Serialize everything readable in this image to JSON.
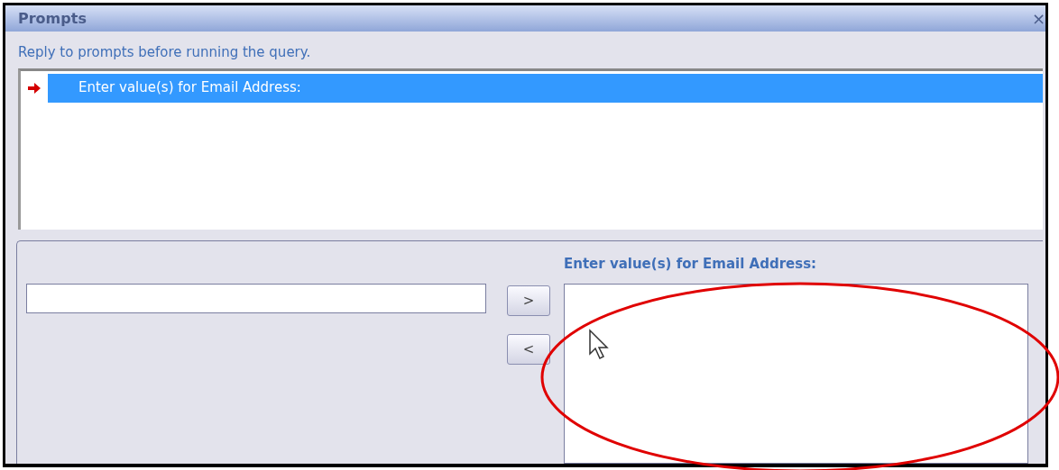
{
  "window": {
    "title": "Prompts",
    "close": "×"
  },
  "instructions": "Reply to prompts before running the query.",
  "prompts": [
    {
      "label": "Enter value(s) for Email Address:",
      "selected": true,
      "required": true
    }
  ],
  "value_entry": {
    "buttons": [
      ">",
      "<"
    ]
  },
  "selected_values": {
    "label": "Enter value(s) for Email Address:"
  }
}
